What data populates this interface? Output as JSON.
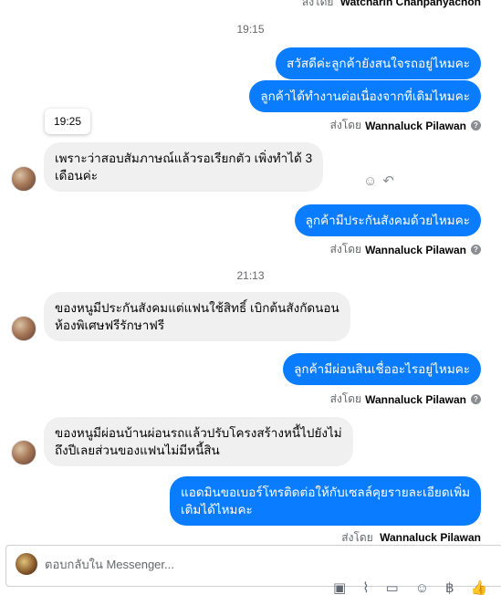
{
  "thread": {
    "top_sender": {
      "prefix": "ส่งโดย",
      "name": "Watcharin Chanpanyachon"
    },
    "times": [
      "19:15",
      "21:13"
    ],
    "tooltip_time": "19:25",
    "sender_prefix": "ส่งโดย",
    "sender_name": "Wannaluck Pilawan",
    "messages": [
      {
        "dir": "out",
        "text": "สวัสดีค่ะลูกค้ายังสนใจรถอยู่ไหมคะ"
      },
      {
        "dir": "out",
        "text": "ลูกค้าได้ทำงานต่อเนื่องจากที่เดิมไหมคะ"
      },
      {
        "dir": "in",
        "line1": "เพราะว่าสอบสัมภาษณ์แล้วรอเรียกตัว เพิ่งทำได้ 3",
        "line2": "เดือนค่ะ"
      },
      {
        "dir": "out",
        "text": "ลูกค้ามีประกันสังคมด้วยไหมคะ"
      },
      {
        "dir": "in",
        "line1": "ของหนูมีประกันสังคมแต่แฟนใช้สิทธิ์ เบิกต้นสังกัดนอน",
        "line2": "ห้องพิเศษฟรีรักษาฟรี"
      },
      {
        "dir": "out",
        "text": "ลูกค้ามีผ่อนสินเชื่ออะไรอยู่ไหมคะ"
      },
      {
        "dir": "in",
        "line1": "ของหนูมีผ่อนบ้านผ่อนรถแล้วปรับโครงสร้างหนี้ไปยังไม่",
        "line2": "ถึงปีเลยส่วนของแฟนไม่มีหนี้สิน"
      },
      {
        "dir": "out",
        "line1": "แอดมินขอเบอร์โทรติดต่อให้กับเซลล์คุยรายละเอียดเพิ่ม",
        "line2": "เติมได้ไหมคะ"
      }
    ],
    "bottom_sender": {
      "prefix": "ส่งโดย",
      "name": "Wannaluck Pilawan"
    }
  },
  "composer": {
    "placeholder": "ตอบกลับใน Messenger..."
  },
  "icons": {
    "info": "info-icon",
    "emoji_react": "smile-icon",
    "reply": "reply-icon",
    "attach_photo": "camera-icon",
    "attach_file": "paperclip-icon",
    "saved_reply": "chat-template-icon",
    "emoji": "emoji-icon",
    "payment": "baht-icon",
    "like": "thumbs-up-icon"
  },
  "colors": {
    "outgoing_bubble": "#0a7cff",
    "incoming_bubble": "#f0f0f0",
    "meta_text": "#65676b"
  }
}
